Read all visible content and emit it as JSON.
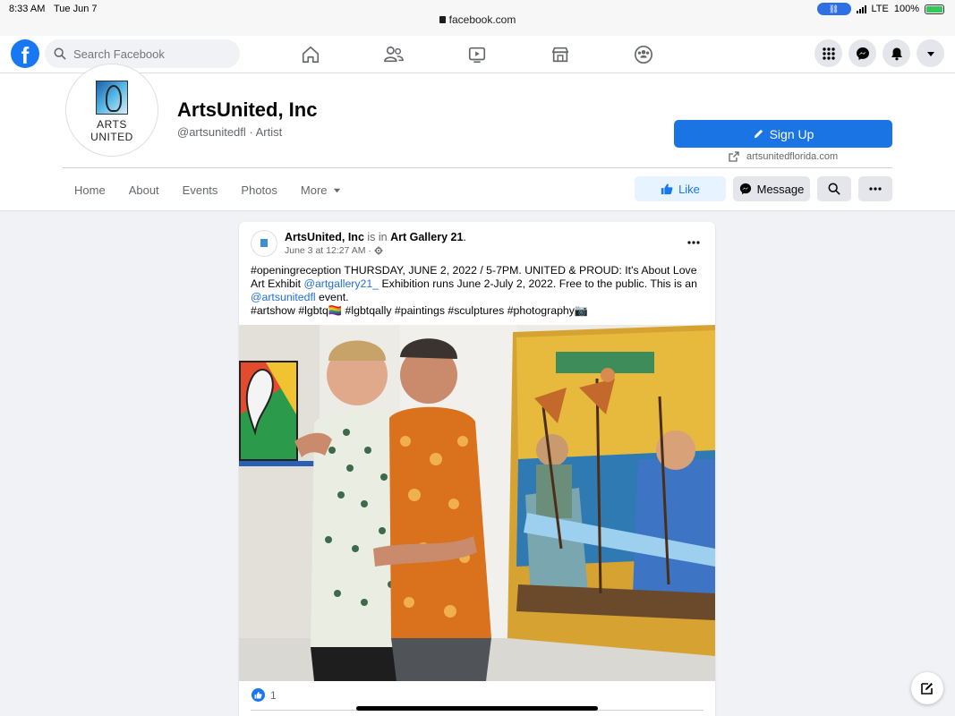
{
  "status_bar": {
    "time": "8:33 AM",
    "date": "Tue Jun 7",
    "url": "facebook.com",
    "network": "LTE",
    "battery": "100%",
    "battery_level": 1.0
  },
  "topnav": {
    "logo_letter": "f",
    "search_placeholder": "Search Facebook",
    "nav_icons": [
      "home-icon",
      "friends-icon",
      "watch-icon",
      "marketplace-icon",
      "groups-icon"
    ],
    "right_icons": [
      "menu-grid-icon",
      "messenger-icon",
      "notifications-icon",
      "account-caret-icon"
    ]
  },
  "page": {
    "avatar_line1": "ARTS",
    "avatar_line2": "UNITED",
    "name": "ArtsUnited, Inc",
    "handle": "@artsunitedfl · Artist",
    "signup_label": "Sign Up",
    "website": "artsunitedflorida.com",
    "tabs": [
      "Home",
      "About",
      "Events",
      "Photos",
      "More"
    ],
    "like_label": "Like",
    "message_label": "Message"
  },
  "post": {
    "author": "ArtsUnited, Inc",
    "is_in": "is in",
    "place": "Art Gallery 21",
    "place_suffix": ".",
    "time": "June 3 at 12:27 AM ·",
    "text_1": "#openingreception THURSDAY, JUNE 2, 2022 / 5-7PM.  UNITED & PROUD: It's About Love Art Exhibit ",
    "mention_1": "@artgallery21_",
    "text_2": "  Exhibition runs June 2-July 2, 2022. Free to the public. This is an ",
    "mention_2": "@artsunitedfl",
    "text_3": " event.",
    "hashtags": "#artshow #lgbtq🏳️‍🌈 #lgbtqally #paintings #sculptures #photography📷",
    "reaction_count": "1"
  },
  "colors": {
    "brand": "#1877f2",
    "signup": "#1b74e4",
    "link": "#216fdb",
    "background": "#f0f2f5"
  }
}
